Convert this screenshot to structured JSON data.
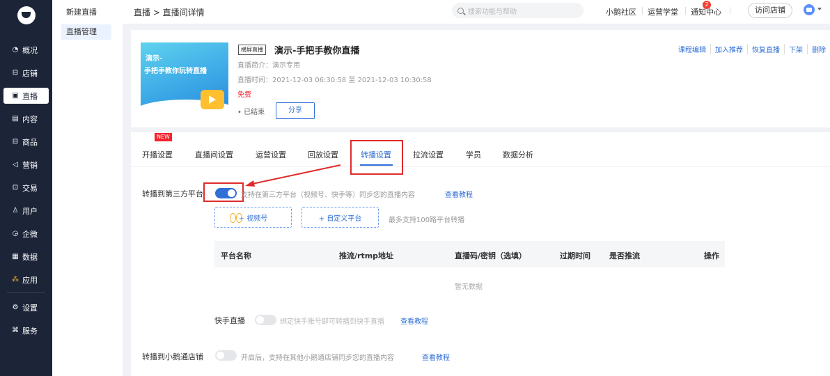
{
  "nav": {
    "items": [
      {
        "icon": "pie-icon",
        "glyph": "◔",
        "label": "概况"
      },
      {
        "icon": "store-icon",
        "glyph": "⊟",
        "label": "店铺"
      },
      {
        "icon": "live-icon",
        "glyph": "▣",
        "label": "直播",
        "active": true
      },
      {
        "icon": "content-icon",
        "glyph": "▤",
        "label": "内容"
      },
      {
        "icon": "goods-icon",
        "glyph": "⊟",
        "label": "商品"
      },
      {
        "icon": "marketing-icon",
        "glyph": "◁",
        "label": "营销"
      },
      {
        "icon": "trade-icon",
        "glyph": "⊡",
        "label": "交易"
      },
      {
        "icon": "user-icon",
        "glyph": "♙",
        "label": "用户"
      },
      {
        "icon": "wecom-icon",
        "glyph": "◶",
        "label": "企微"
      },
      {
        "icon": "data-icon",
        "glyph": "▦",
        "label": "数据"
      },
      {
        "icon": "apps-icon",
        "glyph": "⁂",
        "label": "应用"
      }
    ],
    "bottom": [
      {
        "icon": "gear-icon",
        "glyph": "⚙",
        "label": "设置"
      },
      {
        "icon": "service-icon",
        "glyph": "⌘",
        "label": "服务"
      }
    ]
  },
  "subnav": {
    "new_live": "新建直播",
    "manage": "直播管理"
  },
  "topbar": {
    "breadcrumb": "直播 > 直播间详情",
    "search_placeholder": "搜索功能与帮助",
    "community": "小鹅社区",
    "academy": "运营学堂",
    "notice": "通知中心",
    "notice_count": "2",
    "visit_store": "访问店铺"
  },
  "live": {
    "thumb_line1": "演示-",
    "thumb_line2": "手把手教你玩转直播",
    "tag": "横屏直播",
    "title": "演示-手把手教你直播",
    "intro": "直播简介：演示专用",
    "time": "直播时间：2021-12-03 06:30:58 至 2021-12-03 10:30:58",
    "price": "免费",
    "status": "• 已结束",
    "share": "分享",
    "actions": [
      "课程编辑",
      "加入推荐",
      "恢复直播",
      "下架",
      "删除"
    ]
  },
  "tabs": {
    "new_badge": "NEW",
    "items": [
      "开播设置",
      "直播间设置",
      "运营设置",
      "回放设置",
      "转播设置",
      "拉流设置",
      "学员",
      "数据分析"
    ],
    "active_index": 4
  },
  "relay": {
    "label": "转播到第三方平台",
    "enabled": true,
    "help": "支持在第三方平台（视频号、快手等）同步您的直播内容",
    "tutorial": "查看教程",
    "add_channels": "+ 视频号",
    "add_custom": "+ 自定义平台",
    "limit_note": "最多支持100路平台转播",
    "table_headers": [
      "平台名称",
      "推流/rtmp地址",
      "直播码/密钥（选填）",
      "过期时间",
      "是否推流",
      "操作"
    ],
    "empty_text": "暂无数据",
    "kuaishou_label": "快手直播",
    "kuaishou_enabled": false,
    "kuaishou_help": "绑定快手账号即可转播到快手直播",
    "kuaishou_tutorial": "查看教程"
  },
  "xiaoe": {
    "label": "转播到小鹅通店铺",
    "enabled": false,
    "help": "开启后，支持在其他小鹅通店铺同步您的直播内容",
    "tutorial": "查看教程"
  },
  "colors": {
    "accent": "#2f6fd6",
    "nav_bg": "#1c2438",
    "annotation_red": "#e02b2b"
  }
}
